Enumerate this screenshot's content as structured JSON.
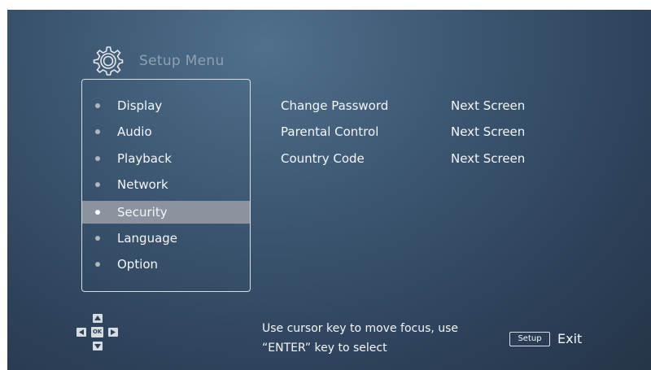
{
  "header": {
    "title": "Setup Menu"
  },
  "sidebar": {
    "items": [
      {
        "label": "Display"
      },
      {
        "label": "Audio"
      },
      {
        "label": "Playback"
      },
      {
        "label": "Network"
      },
      {
        "label": "Security",
        "selected": true
      },
      {
        "label": "Language"
      },
      {
        "label": "Option"
      }
    ]
  },
  "content": {
    "rows": [
      {
        "label": "Change Password",
        "value": "Next Screen"
      },
      {
        "label": "Parental Control",
        "value": "Next Screen"
      },
      {
        "label": "Country Code",
        "value": "Next Screen"
      }
    ]
  },
  "footer": {
    "ok_key": "OK",
    "hint_line1": "Use cursor key to move focus, use",
    "hint_line2": "“ENTER” key to select",
    "setup_key": "Setup",
    "exit_label": "Exit"
  },
  "icons": {
    "title_icon": "gear-icon",
    "dpad": [
      "arrow-up-icon",
      "arrow-left-icon",
      "ok-key",
      "arrow-right-icon",
      "arrow-down-icon"
    ]
  },
  "colors": {
    "background_center": "#50708c",
    "background_edge": "#253549",
    "selection": "#8b949e"
  }
}
